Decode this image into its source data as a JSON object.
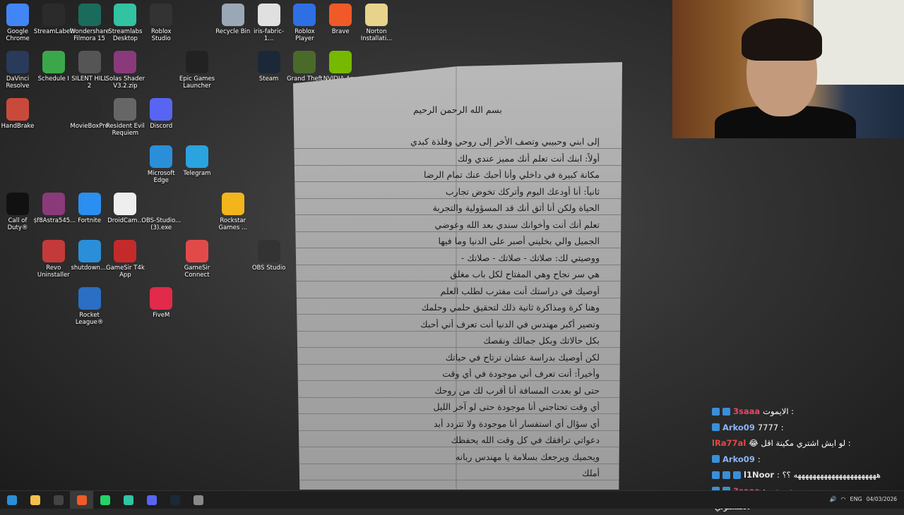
{
  "desktop_icons": [
    {
      "label": "Google Chrome",
      "icon": "chrome-icon",
      "color": "#4285f4"
    },
    {
      "label": "StreamLabels",
      "icon": "streamlabels-icon",
      "color": "#2b2b2b"
    },
    {
      "label": "Wondershare Filmora 15",
      "icon": "filmora-icon",
      "color": "#1a6b5c"
    },
    {
      "label": "Streamlabs Desktop",
      "icon": "streamlabs-icon",
      "color": "#31c3a2"
    },
    {
      "label": "Roblox Studio",
      "icon": "roblox-studio-icon",
      "color": "#333333"
    },
    {
      "label": "Recycle Bin",
      "icon": "recycle-bin-icon",
      "color": "#9aa8b6"
    },
    {
      "label": "iris-fabric-1...",
      "icon": "java-icon",
      "color": "#e0e0e0"
    },
    {
      "label": "Roblox Player",
      "icon": "roblox-icon",
      "color": "#2f6fe4"
    },
    {
      "label": "Brave",
      "icon": "brave-icon",
      "color": "#f05a28"
    },
    {
      "label": "Norton Installati...",
      "icon": "folder-icon",
      "color": "#e7d38c"
    },
    {
      "label": "DaVinci Resolve",
      "icon": "davinci-icon",
      "color": "#2a3a5a"
    },
    {
      "label": "Schedule I",
      "icon": "schedule-icon",
      "color": "#3aa84a"
    },
    {
      "label": "SILENT HILL 2",
      "icon": "silent-hill-icon",
      "color": "#555555"
    },
    {
      "label": "Solas Shader V3.2.zip",
      "icon": "winrar-icon",
      "color": "#8a3a7a"
    },
    {
      "label": "Epic Games Launcher",
      "icon": "epic-icon",
      "color": "#222222"
    },
    {
      "label": "Steam",
      "icon": "steam-icon",
      "color": "#1b2838"
    },
    {
      "label": "Grand Theft Auto V",
      "icon": "gta-icon",
      "color": "#4a6a2a"
    },
    {
      "label": "NVIDIA App",
      "icon": "nvidia-icon",
      "color": "#76b900"
    },
    {
      "label": "HandBrake",
      "icon": "handbrake-icon",
      "color": "#c94a3a"
    },
    {
      "label": "MovieBoxPro",
      "icon": "moviebox-icon",
      "color": "#2a2a2a"
    },
    {
      "label": "Resident Evil Requiem",
      "icon": "resident-evil-icon",
      "color": "#666666"
    },
    {
      "label": "Discord",
      "icon": "discord-icon",
      "color": "#5865f2"
    },
    {
      "label": "Microsoft Edge",
      "icon": "edge-icon",
      "color": "#2a8fd8"
    },
    {
      "label": "Telegram",
      "icon": "telegram-icon",
      "color": "#2aa3de"
    },
    {
      "label": "Call of Duty®",
      "icon": "cod-icon",
      "color": "#111111"
    },
    {
      "label": "ṩf8Astra545...",
      "icon": "winrar-icon",
      "color": "#8a3a7a"
    },
    {
      "label": "Fortnite",
      "icon": "fortnite-icon",
      "color": "#2a8ff0"
    },
    {
      "label": "DroidCam...",
      "icon": "droidcam-icon",
      "color": "#eeeeee"
    },
    {
      "label": "OBS-Studio... (3).exe",
      "icon": "obs-icon",
      "color": "#333333"
    },
    {
      "label": "Rockstar Games ...",
      "icon": "rockstar-icon",
      "color": "#f2b51b"
    },
    {
      "label": "Revo Uninstaller",
      "icon": "revo-icon",
      "color": "#c43a3a"
    },
    {
      "label": "shutdown....",
      "icon": "shutdown-icon",
      "color": "#2a8fd8"
    },
    {
      "label": "GameSir T4k App",
      "icon": "gamesir-icon",
      "color": "#c42a2a"
    },
    {
      "label": "GameSir Connect",
      "icon": "gamesir-connect-icon",
      "color": "#e24a4a"
    },
    {
      "label": "OBS Studio",
      "icon": "obs-icon",
      "color": "#333333"
    },
    {
      "label": "Rocket League®",
      "icon": "rocket-league-icon",
      "color": "#2a6fc4"
    },
    {
      "label": "FiveM",
      "icon": "fivem-icon",
      "color": "#e22a4a"
    }
  ],
  "letter": {
    "heading": "بسم الله الرحمن الرحيم",
    "lines": [
      "إلى ابني وحبيبي وتصف الأخر إلى روحي وفلذة كبدي",
      "أولاً: ابنك أنت تعلم أنك مميز عندي ولك",
      "مكانة كبيرة في داخلي وأنا أحبك عنك تمام الرضا",
      "ثانياً: أنا أودعك اليوم وأتركك تخوض تجارب",
      "الحياة ولكن أنا أثق أنك قد المسؤولية والتجربة",
      "تعلم أنك أنت وأخوانك سندي بعد الله وعوضي",
      "الجميل والي بخليني أصبر على الدنيا وما فيها",
      "ووصيتي لك: صلاتك - صلاتك - صلاتك -",
      "هي سر نجاح وهي المفتاح لكل باب مغلق",
      "أوصيك في دراستك أنت مفترب لطلب العلم",
      "وهنا كرة ومذاكرة ثانية ذلك لتحقيق حلمي وحلمك",
      "وتصير أكبر مهندس في الدنيا أنت تعرف أني أحبك",
      "بكل حالاتك وبكل جمالك ونقصك",
      "لكن أوصيك بدراسة عشان ترتاح في حياتك",
      "وأخيراً: أنت تعرف أني موجودة في أي وقت",
      "حتى لو بعدت المسافة أنا أقرب لك من روحك",
      "أي وقت تحتاجني أنا موجودة حتى لو آخر الليل",
      "أي سؤال أي استفسار أنا موجودة ولا تتردد أبد",
      "دعواتي ترافقك في كل وقت الله يحفظك",
      "ويحميك ويرجعك بسلامة يا مهندس ربانه",
      "أملك"
    ]
  },
  "chat": [
    {
      "user": "3saaa",
      "user_color": "#e24a6a",
      "msg": "الايموت :",
      "badges": 2
    },
    {
      "user": "Arko09",
      "user_color": "#8ab4f8",
      "msg": "7777 :",
      "badges": 1
    },
    {
      "user": "lRa77al",
      "user_color": "#e24a4a",
      "msg": "😂 لو ايش اشتري مكينة اقل :",
      "badges": 0
    },
    {
      "user": "Arko09",
      "user_color": "#8ab4f8",
      "msg": ":",
      "badges": 1
    },
    {
      "user": "l1Noor",
      "user_color": "#e2e2e2",
      "msg": ": ههههههههههههههههههههههه ؟؟",
      "badges": 3
    },
    {
      "user": "3saaa",
      "user_color": "#e24a6a",
      "msg": ": هيه ههه",
      "badges": 2
    },
    {
      "user": "",
      "user_color": "#ffffff",
      "msg": "لاتكنسلوني",
      "badges": 0
    }
  ],
  "taskbar": {
    "items": [
      {
        "icon": "windows-start-icon",
        "color": "#2a8fd8"
      },
      {
        "icon": "file-explorer-icon",
        "color": "#f2c14a"
      },
      {
        "icon": "obs-icon",
        "color": "#444444"
      },
      {
        "icon": "brave-icon",
        "color": "#f05a28"
      },
      {
        "icon": "whatsapp-icon",
        "color": "#25d366"
      },
      {
        "icon": "streamlabs-icon",
        "color": "#31c3a2"
      },
      {
        "icon": "discord-icon",
        "color": "#5865f2"
      },
      {
        "icon": "steam-icon",
        "color": "#1b2838"
      },
      {
        "icon": "gear-icon",
        "color": "#888888"
      }
    ],
    "language": "ENG",
    "date": "04/03/2026"
  }
}
